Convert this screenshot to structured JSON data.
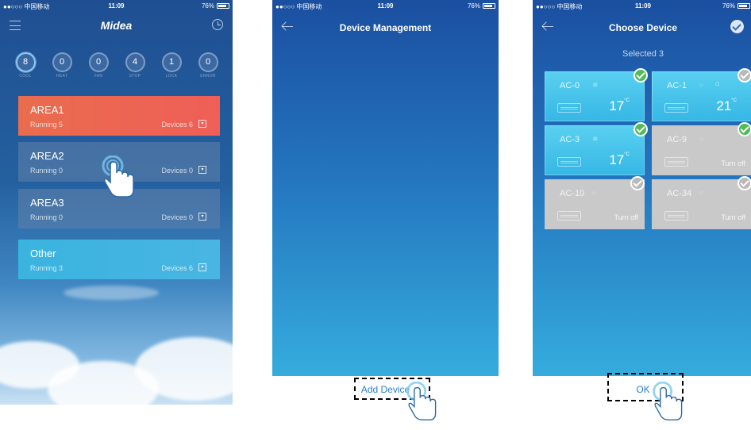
{
  "status_bar": {
    "carrier": "●●○○○ 中国移动 ",
    "time": "11:09",
    "battery": "76%"
  },
  "screen1": {
    "brand": "Midea",
    "stats": [
      {
        "value": "8",
        "label": "COOL"
      },
      {
        "value": "0",
        "label": "HEAT"
      },
      {
        "value": "0",
        "label": "FAN"
      },
      {
        "value": "4",
        "label": "STOP"
      },
      {
        "value": "1",
        "label": "LOCK"
      },
      {
        "value": "0",
        "label": "ERROR"
      }
    ],
    "areas": [
      {
        "name": "AREA1",
        "running": "Running 5",
        "devices": "Devices 6"
      },
      {
        "name": "AREA2",
        "running": "Running 0",
        "devices": "Devices 0"
      },
      {
        "name": "AREA3",
        "running": "Running 0",
        "devices": "Devices 0"
      },
      {
        "name": "Other",
        "running": "Running 3",
        "devices": "Devices 6"
      }
    ]
  },
  "screen2": {
    "title": "Device Management",
    "add_button": "Add Device"
  },
  "screen3": {
    "title": "Choose Device",
    "selected": "Selected 3",
    "cards": [
      {
        "name": "AC-0",
        "temp": "17",
        "unit": "°C",
        "selected": true
      },
      {
        "name": "AC-1",
        "temp": "21",
        "unit": "°C",
        "selected": false
      },
      {
        "name": "AC-3",
        "temp": "17",
        "unit": "°C",
        "selected": true
      },
      {
        "name": "AC-9",
        "state": "Turn off",
        "selected": true
      },
      {
        "name": "AC-10",
        "state": "Turn off",
        "selected": false
      },
      {
        "name": "AC-34",
        "state": "Turn off",
        "selected": false
      }
    ],
    "ok_button": "OK"
  },
  "icons": [
    "menu-icon",
    "clock-icon",
    "back-icon",
    "confirm-check-icon",
    "hand-pointer-icon",
    "dropdown-icon",
    "snowflake-icon",
    "lock-icon"
  ]
}
